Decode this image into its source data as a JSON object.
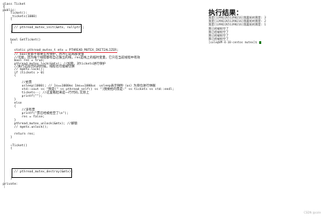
{
  "code_lines": [
    {
      "text": "class Ticket",
      "cls": "kw"
    },
    {
      "text": "{",
      "cls": ""
    },
    {
      "text": "public:",
      "cls": "kw"
    },
    {
      "text": "    Ticket():",
      "cls": ""
    },
    {
      "text": "    _tickets(1000)",
      "cls": ""
    },
    {
      "text": "    {",
      "cls": ""
    },
    {
      "text": "      // pthread_mutex_init(&mtx, nullptr);",
      "cls": "cm"
    },
    {
      "text": "    }",
      "cls": ""
    },
    {
      "text": "",
      "cls": ""
    },
    {
      "text": "    bool GetTicket()",
      "cls": ""
    },
    {
      "text": "    {",
      "cls": ""
    },
    {
      "text": "      static pthread_mutex_t mtx = PTHREAD_MUTEX_INITIALIZER;",
      "cls": "mac"
    },
    {
      "text": "      // bool变量不需要互斥保护，因为它是局部变量",
      "cls": "cm"
    },
    {
      "text": "      //可能，因为每个线程都有自己独立的栈，res是栈上的临时变量，它只在当前线程中有效",
      "cls": "cm"
    },
    {
      "text": "      bool res = true;",
      "cls": ""
    },
    {
      "text": "      pthread_mutex_lock(&mtx); //加锁，对tickets进行保护",
      "cls": ""
    },
    {
      "text": "      //执行这段代码的时候，线程也可能被切换",
      "cls": "cm"
    },
    {
      "text": "      // mymtx.lock();",
      "cls": "cm"
    },
    {
      "text": "      if (tickets > 0)",
      "cls": ""
    },
    {
      "text": "      {",
      "cls": ""
    },
    {
      "text": "",
      "cls": ""
    },
    {
      "text": "          //抢票",
      "cls": "cm"
    },
    {
      "text": "          usleep(1000); // 1s==1000ms 1ms==1000us  usleep表示微秒（us）为单位进行休眠",
      "cls": ""
    },
    {
      "text": "          std::cout << \"我是[\" << pthread_self() << \"]我要抢的票是:\" << tickets << std::endl;",
      "cls": ""
    },
    {
      "text": "          tickets--; //这里看起来是一行代码,实际上",
      "cls": ""
    },
    {
      "text": "          printf(\"\");",
      "cls": ""
    },
    {
      "text": "      }",
      "cls": ""
    },
    {
      "text": "      else",
      "cls": "kw"
    },
    {
      "text": "      {",
      "cls": ""
    },
    {
      "text": "          //没有票",
      "cls": "cm"
    },
    {
      "text": "          printf(\"票已经被抢空了\\n\");",
      "cls": ""
    },
    {
      "text": "          res = false;",
      "cls": ""
    },
    {
      "text": "      }",
      "cls": ""
    },
    {
      "text": "      pthread_mutex_unlock(&mtx); //解锁",
      "cls": ""
    },
    {
      "text": "      // mymtx.unlock();",
      "cls": "cm"
    },
    {
      "text": "",
      "cls": ""
    },
    {
      "text": "      return res;",
      "cls": ""
    },
    {
      "text": "    }",
      "cls": ""
    },
    {
      "text": "",
      "cls": ""
    },
    {
      "text": "    ~Ticket()",
      "cls": ""
    },
    {
      "text": "    {",
      "cls": ""
    },
    {
      "text": "",
      "cls": ""
    },
    {
      "text": "      // pthread_mutex_destroy(&mtx);",
      "cls": "cm"
    },
    {
      "text": "",
      "cls": ""
    },
    {
      "text": "    }",
      "cls": ""
    },
    {
      "text": "",
      "cls": ""
    },
    {
      "text": "private:",
      "cls": "kw"
    }
  ],
  "output": {
    "title": "执行结果：",
    "lines": [
      "我是[139822651390216]我要抢的票是: 3",
      "我是[139822651390216]我要抢的票是: 2",
      "我是[139822651390216]我要抢的票是: 1",
      "票已经被抢空了",
      "票已经被抢空了",
      "票已经被抢空了",
      "票已经被抢空了",
      "[cole@VM-4-10-centos mutex]$ "
    ]
  },
  "watermark": "CSDN @cole"
}
